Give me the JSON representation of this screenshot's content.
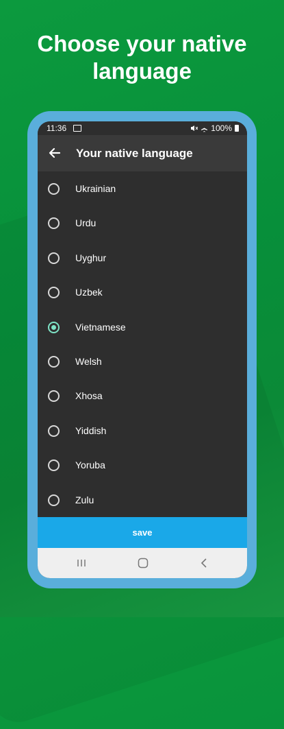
{
  "headline": "Choose your native language",
  "status_bar": {
    "time": "11:36",
    "battery": "100%"
  },
  "app_bar": {
    "title": "Your native language"
  },
  "languages": [
    {
      "label": "Ukrainian",
      "selected": false
    },
    {
      "label": "Urdu",
      "selected": false
    },
    {
      "label": "Uyghur",
      "selected": false
    },
    {
      "label": "Uzbek",
      "selected": false
    },
    {
      "label": "Vietnamese",
      "selected": true
    },
    {
      "label": "Welsh",
      "selected": false
    },
    {
      "label": "Xhosa",
      "selected": false
    },
    {
      "label": "Yiddish",
      "selected": false
    },
    {
      "label": "Yoruba",
      "selected": false
    },
    {
      "label": "Zulu",
      "selected": false
    }
  ],
  "save_label": "save",
  "colors": {
    "accent": "#1aa8e8",
    "radio_selected": "#7ee3c6",
    "background": "#0c9a3e",
    "phone_frame": "#5aaedb"
  }
}
